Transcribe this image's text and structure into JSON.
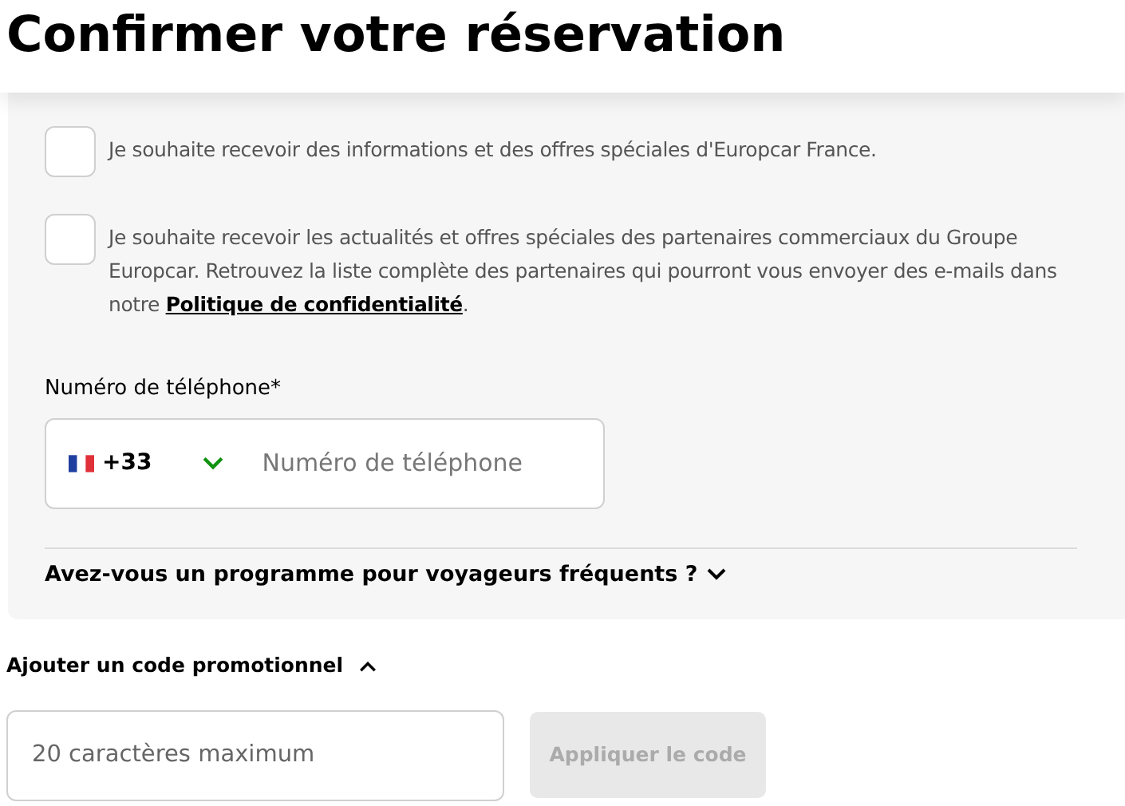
{
  "title": "Confirmer votre réservation",
  "consents": [
    {
      "text": "Je souhaite recevoir des informations et des offres spéciales d'Europcar France.",
      "checked": false
    },
    {
      "text": "Je souhaite recevoir les actualités et offres spéciales des partenaires commerciaux du Groupe Europcar. Retrouvez la liste complète des partenaires qui pourront vous envoyer des e-mails dans notre ",
      "link": "Politique de confidentialité",
      "after": ".",
      "checked": false
    }
  ],
  "phone": {
    "label": "Numéro de téléphone*",
    "country_code": "+33",
    "placeholder": "Numéro de téléphone"
  },
  "frequent_flyer": {
    "label": "Avez-vous un programme pour voyageurs fréquents ?",
    "expanded": false
  },
  "promo": {
    "label": "Ajouter un code promotionnel",
    "expanded": true,
    "placeholder": "20 caractères maximum",
    "button": {
      "label": "Appliquer le code",
      "disabled": true
    }
  }
}
